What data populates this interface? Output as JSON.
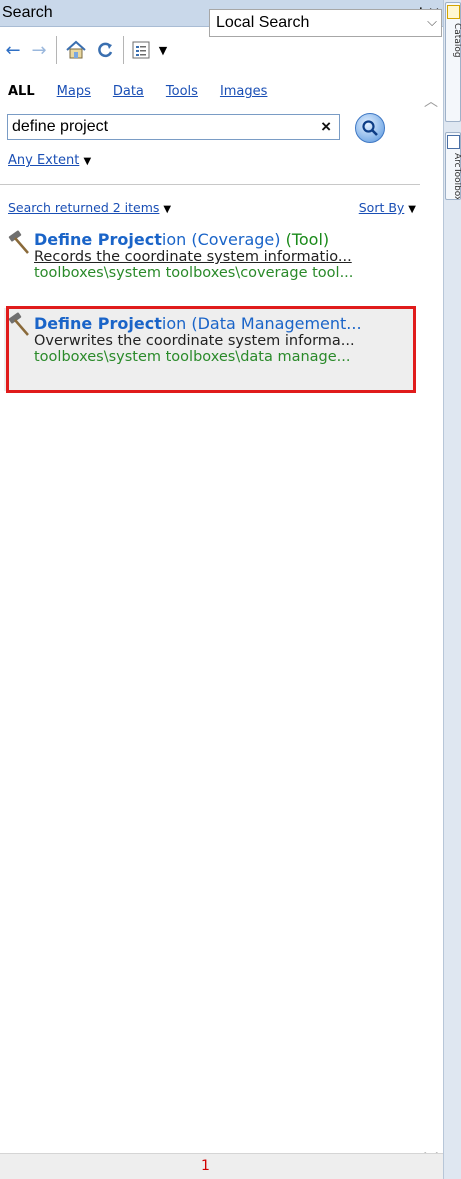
{
  "window": {
    "title": "Search",
    "pin_icon": "pin-icon",
    "close_icon": "close-icon"
  },
  "toolbar": {
    "back_icon": "back-arrow-icon",
    "forward_icon": "forward-arrow-icon",
    "home_icon": "home-icon",
    "refresh_icon": "refresh-icon",
    "view_icon": "list-view-icon",
    "scope_select": "Local Search"
  },
  "categories": {
    "all": "ALL",
    "maps": "Maps",
    "data": "Data",
    "tools": "Tools",
    "images": "Images"
  },
  "search": {
    "query": "define project",
    "clear_label": "×",
    "extent_label": "Any Extent"
  },
  "results": {
    "summary": "Search returned 2 items",
    "sort_label": "Sort By",
    "items": [
      {
        "title_match": "Define Project",
        "title_rest": "ion (Coverage)",
        "title_type": " (Tool)",
        "description": "Records the coordinate system informatio...",
        "path": "toolboxes\\system toolboxes\\coverage tool..."
      },
      {
        "title_match": "Define Project",
        "title_rest": "ion (Data Management...",
        "description": "Overwrites the coordinate system informa...",
        "path": "toolboxes\\system toolboxes\\data manage..."
      }
    ]
  },
  "status": {
    "page_number": "1"
  },
  "side_tabs": {
    "tab1_label": "Catalog",
    "tab2_label": "ArcToolbox"
  },
  "colors": {
    "link": "#1a4fb5",
    "title_blue": "#1a64c8",
    "path_green": "#2a8a2a",
    "highlight_red": "#e01b1b"
  }
}
